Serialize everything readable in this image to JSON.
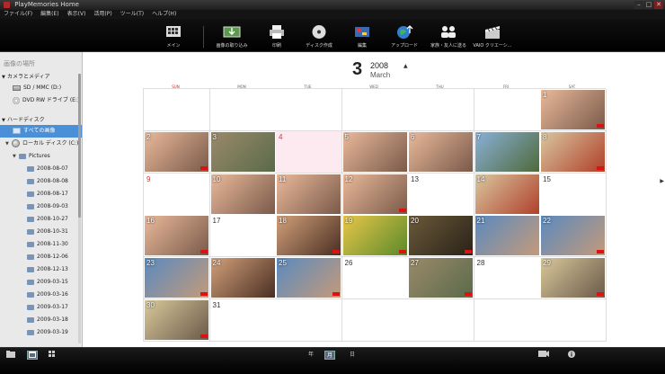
{
  "window": {
    "title": "PlayMemories Home"
  },
  "menu": [
    "ファイル(F)",
    "編集(E)",
    "表示(V)",
    "活用(P)",
    "ツール(T)",
    "ヘルプ(H)"
  ],
  "toolbar": [
    {
      "label": "メイン",
      "icon": "main-icon"
    },
    {
      "label": "画像の取り込み",
      "icon": "import-icon"
    },
    {
      "label": "印刷",
      "icon": "print-icon"
    },
    {
      "label": "ディスク作成",
      "icon": "disc-icon"
    },
    {
      "label": "編集",
      "icon": "edit-icon"
    },
    {
      "label": "アップロード",
      "icon": "upload-icon"
    },
    {
      "label": "家族・友人に送る",
      "icon": "share-icon"
    },
    {
      "label": "VAIO クリエーシ...",
      "icon": "vaio-create-icon"
    }
  ],
  "sidebar": {
    "heading": "画像の場所",
    "camera_section": "カメラとメディア",
    "media": [
      "SD / MMC (D:)",
      "DVD RW ドライブ (E:)"
    ],
    "hdd_section": "ハードディスク",
    "all_images": "すべての画像",
    "local_disk": "ローカル ディスク (C:)",
    "pictures": "Pictures",
    "folders": [
      "2008-08-07",
      "2008-08-08",
      "2008-08-17",
      "2008-09-03",
      "2008-10-27",
      "2008-10-31",
      "2008-11-30",
      "2008-12-06",
      "2008-12-13",
      "2009-03-15",
      "2009-03-16",
      "2009-03-17",
      "2009-03-18",
      "2009-03-19"
    ]
  },
  "calendar": {
    "month_num": "3",
    "year": "2008",
    "month_name": "March",
    "weekdays": [
      "SUN",
      "MON",
      "TUE",
      "WED",
      "THU",
      "FRI",
      "SAT"
    ],
    "today": 4,
    "first_weekday": 6,
    "days_in_month": 31,
    "photos": {
      "1": "child",
      "2": "child",
      "3": "tortoise",
      "5": "child",
      "6": "child",
      "7": "mountain",
      "8": "food",
      "10": "child",
      "11": "child",
      "12": "child",
      "14": "food",
      "16": "child",
      "18": "woman",
      "19": "flowers",
      "20": "street",
      "21": "couple",
      "22": "couple",
      "23": "couple",
      "24": "woman",
      "25": "couple",
      "27": "tortoise",
      "29": "beach",
      "30": "beach"
    },
    "video_days": [
      1,
      2,
      8,
      12,
      16,
      18,
      19,
      20,
      22,
      23,
      25,
      27,
      29,
      30
    ],
    "photo_colors": {
      "child": [
        "#e9b99a",
        "#7a5a4a"
      ],
      "tortoise": [
        "#9a8a6a",
        "#5a6a4a"
      ],
      "mountain": [
        "#8ab0d8",
        "#4e6a3a"
      ],
      "food": [
        "#d9c7a0",
        "#b0402a"
      ],
      "woman": [
        "#d1a07a",
        "#4a2e22"
      ],
      "flowers": [
        "#e8c64a",
        "#5a8a2a"
      ],
      "street": [
        "#6a5a3a",
        "#2a2218"
      ],
      "couple": [
        "#5a8abf",
        "#c49a7a"
      ],
      "beach": [
        "#d9c89a",
        "#6a5a4a"
      ]
    }
  },
  "status": {
    "year_btn": "年",
    "month_btn": "月",
    "day_btn": "日"
  }
}
